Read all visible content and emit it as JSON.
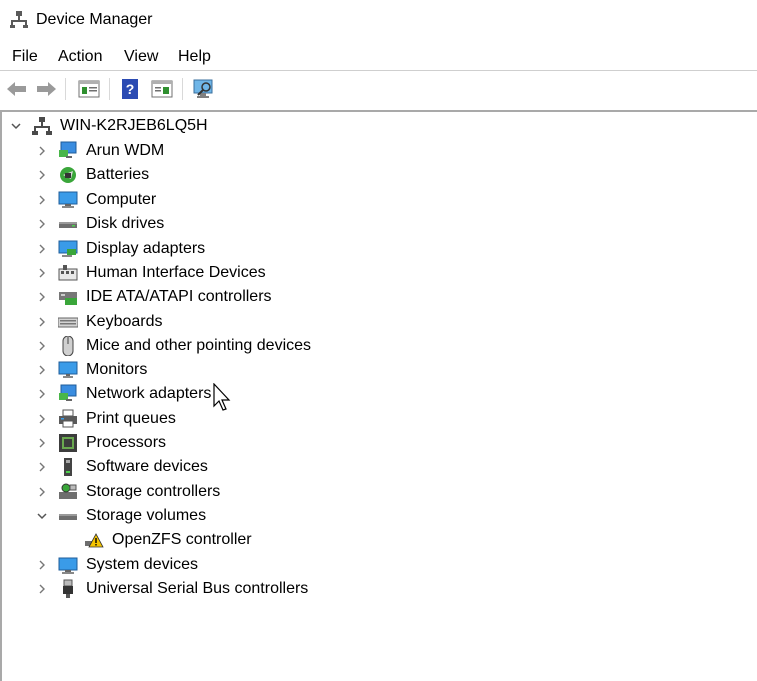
{
  "window": {
    "title": "Device Manager"
  },
  "menu": [
    "File",
    "Action",
    "View",
    "Help"
  ],
  "toolbar": {
    "icons": [
      "back-arrow-icon",
      "forward-arrow-icon",
      "properties-icon",
      "help-icon",
      "update-driver-icon",
      "scan-hardware-icon"
    ]
  },
  "tree": {
    "root": "WIN-K2RJEB6LQ5H",
    "items": [
      {
        "label": "Arun WDM",
        "icon": "network-icon",
        "expanded": false
      },
      {
        "label": "Batteries",
        "icon": "battery-icon",
        "expanded": false
      },
      {
        "label": "Computer",
        "icon": "computer-icon",
        "expanded": false
      },
      {
        "label": "Disk drives",
        "icon": "disk-drive-icon",
        "expanded": false
      },
      {
        "label": "Display adapters",
        "icon": "display-adapter-icon",
        "expanded": false
      },
      {
        "label": "Human Interface Devices",
        "icon": "hid-icon",
        "expanded": false
      },
      {
        "label": "IDE ATA/ATAPI controllers",
        "icon": "ide-controller-icon",
        "expanded": false
      },
      {
        "label": "Keyboards",
        "icon": "keyboard-icon",
        "expanded": false
      },
      {
        "label": "Mice and other pointing devices",
        "icon": "mouse-icon",
        "expanded": false
      },
      {
        "label": "Monitors",
        "icon": "monitor-icon",
        "expanded": false
      },
      {
        "label": "Network adapters",
        "icon": "network-adapter-icon",
        "expanded": false
      },
      {
        "label": "Print queues",
        "icon": "printer-icon",
        "expanded": false
      },
      {
        "label": "Processors",
        "icon": "processor-icon",
        "expanded": false
      },
      {
        "label": "Software devices",
        "icon": "software-device-icon",
        "expanded": false
      },
      {
        "label": "Storage controllers",
        "icon": "storage-controller-icon",
        "expanded": false
      },
      {
        "label": "Storage volumes",
        "icon": "storage-volume-icon",
        "expanded": true
      },
      {
        "label": "OpenZFS controller",
        "icon": "warning-icon",
        "child": true
      },
      {
        "label": "System devices",
        "icon": "system-device-icon",
        "expanded": false
      },
      {
        "label": "Universal Serial Bus controllers",
        "icon": "usb-icon",
        "expanded": false
      }
    ]
  }
}
